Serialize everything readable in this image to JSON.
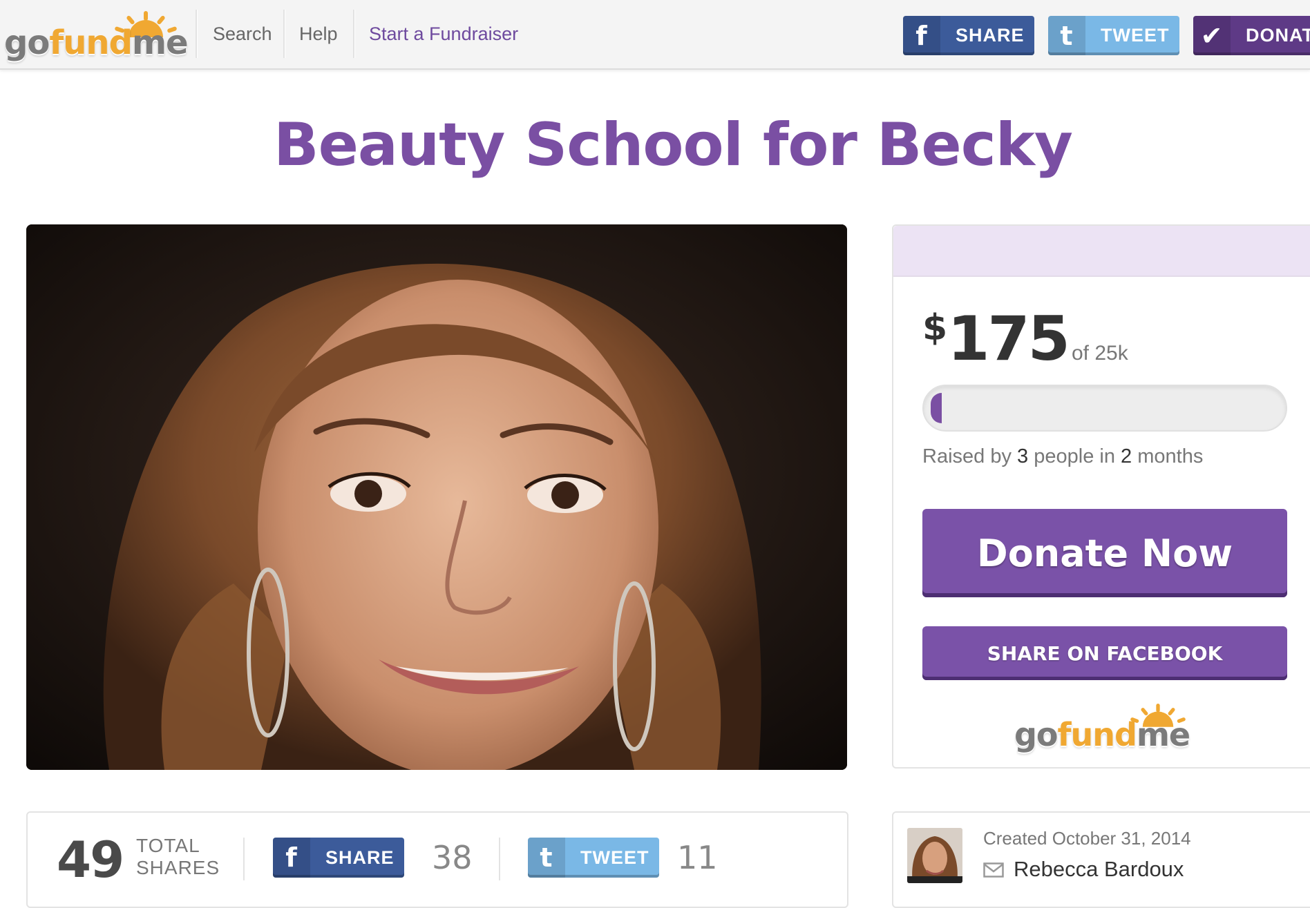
{
  "header": {
    "logo": "gofundme",
    "nav": {
      "search": "Search",
      "help": "Help",
      "start": "Start a Fundraiser"
    },
    "buttons": {
      "share": "SHARE",
      "tweet": "TWEET",
      "donate": "DONATE"
    }
  },
  "campaign": {
    "title": "Beauty School for Becky",
    "image_alt": "Photo of Becky"
  },
  "panel": {
    "currency": "$",
    "raised_amount": "175",
    "goal": "of 25k",
    "progress_fraction": 0.007,
    "raised_by_prefix": "Raised by",
    "people_count": "3",
    "people_suffix": "people in",
    "months_count": "2",
    "months_suffix": "months",
    "donate_label": "Donate Now",
    "share_facebook_label": "SHARE ON FACEBOOK",
    "logo": "gofundme"
  },
  "sharebar": {
    "total_count": "49",
    "total_label_line1": "TOTAL",
    "total_label_line2": "SHARES",
    "share_label": "SHARE",
    "share_count": "38",
    "tweet_label": "TWEET",
    "tweet_count": "11"
  },
  "organizer": {
    "created": "Created October 31, 2014",
    "name": "Rebecca Bardoux"
  },
  "icons": {
    "facebook": "facebook-icon",
    "twitter": "twitter-icon",
    "check": "check-icon",
    "mail": "mail-icon"
  },
  "colors": {
    "brand_purple": "#7a4fa3",
    "facebook_blue": "#3c5b9a",
    "twitter_blue": "#7ab8e6",
    "logo_orange": "#f0a832"
  }
}
